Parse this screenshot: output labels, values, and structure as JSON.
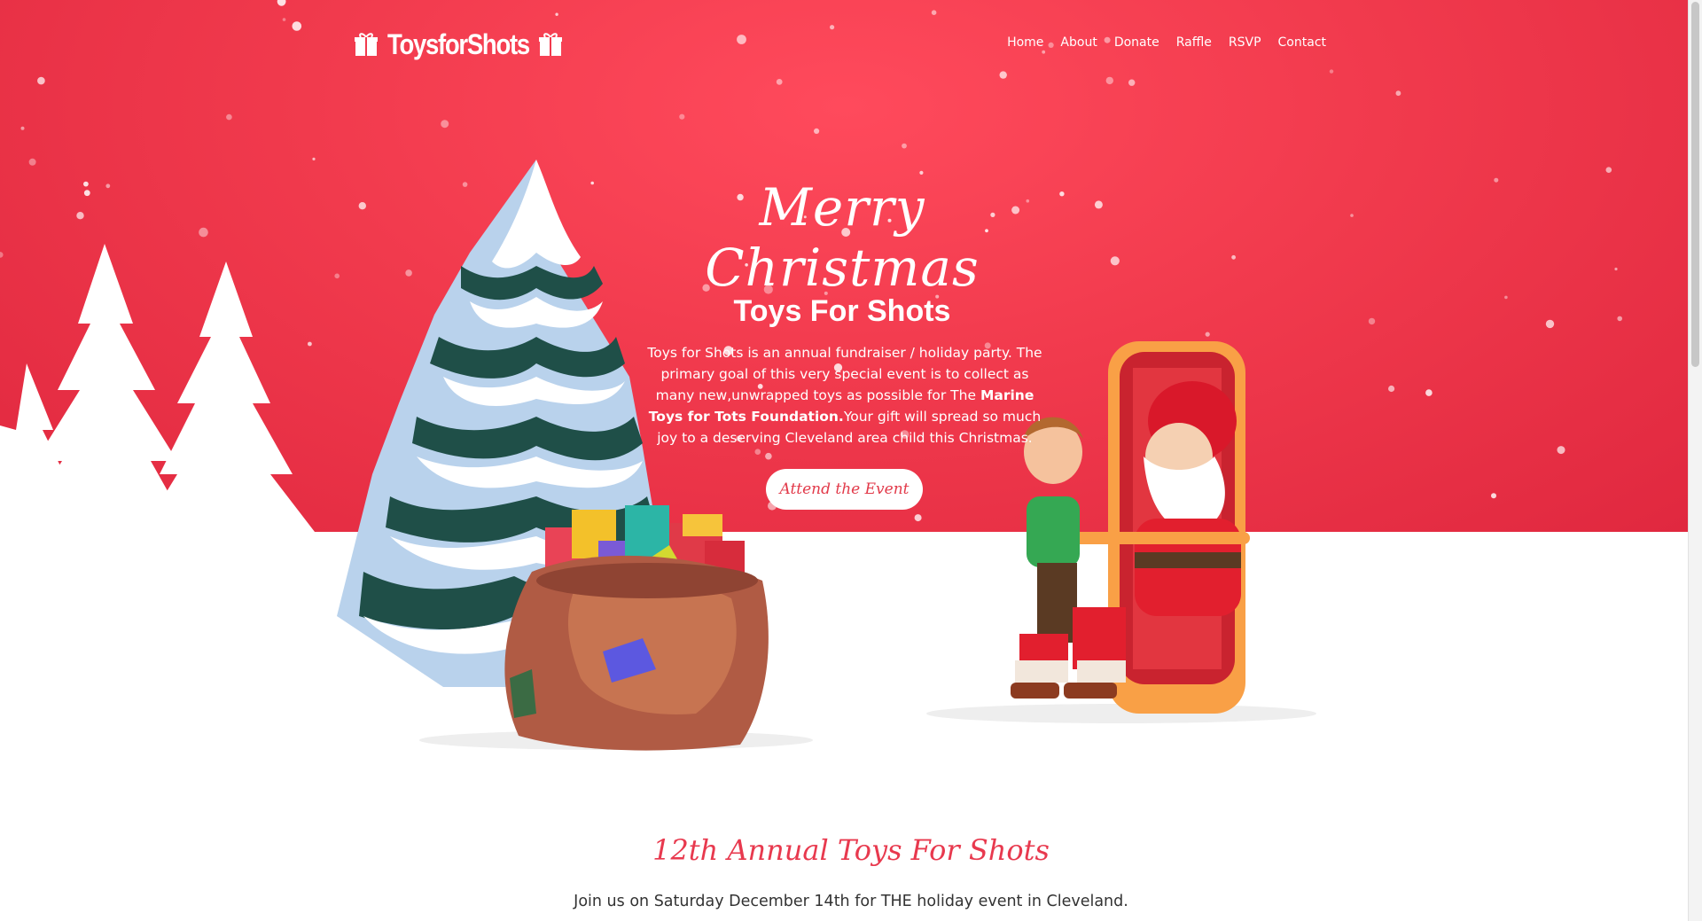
{
  "brand": {
    "name": "ToysforShots"
  },
  "nav": {
    "items": [
      {
        "label": "Home"
      },
      {
        "label": "About"
      },
      {
        "label": "Donate"
      },
      {
        "label": "Raffle"
      },
      {
        "label": "RSVP"
      },
      {
        "label": "Contact"
      }
    ]
  },
  "hero": {
    "script_heading": "Merry Christmas",
    "title": "Toys For Shots",
    "description_part1": "Toys for Shots is an annual fundraiser / holiday party. The primary goal of this very special event is to collect as many new,unwrapped toys as possible for The ",
    "description_bold": "Marine Toys for Tots Foundation.",
    "description_part2": "Your gift will spread so much joy to a deserving Cleveland area child this Christmas.",
    "cta_label": "Attend the Event"
  },
  "annual": {
    "heading": "12th Annual Toys For Shots",
    "subtitle": "Join us on Saturday December 14th for THE holiday event in Cleveland."
  },
  "colors": {
    "hero_red": "#f13a4d",
    "accent": "#e8394e",
    "tree_dark": "#1f4f48",
    "snow": "#ffffff"
  }
}
